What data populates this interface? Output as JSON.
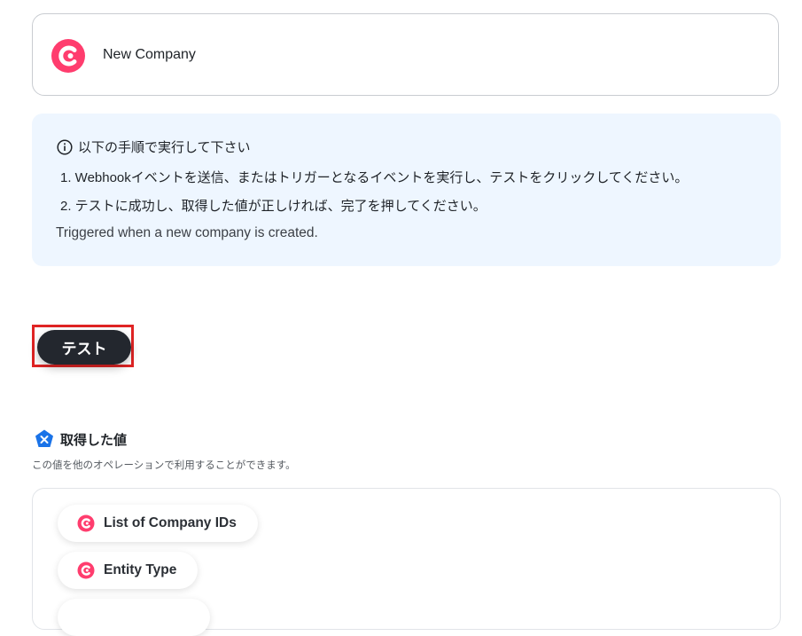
{
  "trigger": {
    "app_icon": "copper-logo-icon",
    "name": "New Company"
  },
  "info": {
    "heading": "以下の手順で実行して下さい",
    "steps": [
      "1. Webhookイベントを送信、またはトリガーとなるイベントを実行し、テストをクリックしてください。",
      "2. テストに成功し、取得した値が正しければ、完了を押してください。"
    ],
    "description": "Triggered when a new company is created."
  },
  "test_button": {
    "label": "テスト"
  },
  "output": {
    "title": "取得した値",
    "description": "この値を他のオペレーションで利用することができます。",
    "fields": [
      {
        "label": "List of Company IDs",
        "icon": "copper-logo-icon"
      },
      {
        "label": "Entity Type",
        "icon": "copper-logo-icon"
      }
    ]
  },
  "colors": {
    "accent_pink": "#ff3d6e",
    "button_dark": "#23272e",
    "info_bg": "#eef6ff",
    "highlight_red": "#e02424",
    "yoom_blue": "#1a73e8"
  }
}
